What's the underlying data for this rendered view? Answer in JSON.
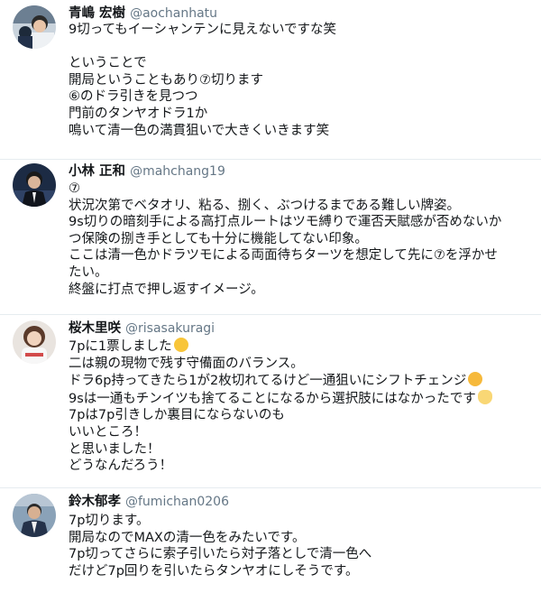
{
  "tweets": [
    {
      "name": "青嶋 宏樹",
      "handle": "@aochanhatu",
      "lines": [
        "9切ってもイーシャンテンに見えないですな笑",
        "",
        "ということで",
        "開局ということもあり⑦切ります",
        "⑥のドラ引きを見つつ",
        "門前のタンヤオドラ1か",
        "鳴いて清一色の満貫狙いで大きくいきます笑"
      ]
    },
    {
      "name": "小林 正和",
      "handle": "@mahchang19",
      "lines": [
        "⑦",
        "状況次第でベタオリ、粘る、捌く、ぶつけるまである難しい牌姿。",
        "9s切りの暗刻手による高打点ルートはツモ縛りで運否天賦感が否めないか",
        "つ保険の捌き手としても十分に機能してない印象。",
        "ここは清一色かドラツモによる両面待ちターツを想定して先に⑦を浮かせ",
        "たい。",
        "終盤に打点で押し返すイメージ。"
      ]
    },
    {
      "name": "桜木里咲",
      "handle": "@risasakuragi",
      "lines": [
        "7pに1票しました",
        "二は親の現物で残す守備面のバランス。",
        "ドラ6p持ってきたら1が2枚切れてるけど一通狙いにシフトチェンジ",
        "9sは一通もチンイツも捨てることになるから選択肢にはなかったです",
        "7pは7p引きしか裏目にならないのも",
        "いいところ！",
        "と思いました！",
        "どうなんだろう！"
      ],
      "emoji": [
        "grinning-sweat-emoji",
        "thinking-face-emoji",
        "raised-hand-emoji"
      ]
    },
    {
      "name": "鈴木郁孝",
      "handle": "@fumichan0206",
      "lines": [
        "7p切ります。",
        "開局なのでMAXの清一色をみたいです。",
        "7p切ってさらに索子引いたら対子落としで清一色へ",
        "だけど7p回りを引いたらタンヤオにしそうです。"
      ]
    }
  ]
}
